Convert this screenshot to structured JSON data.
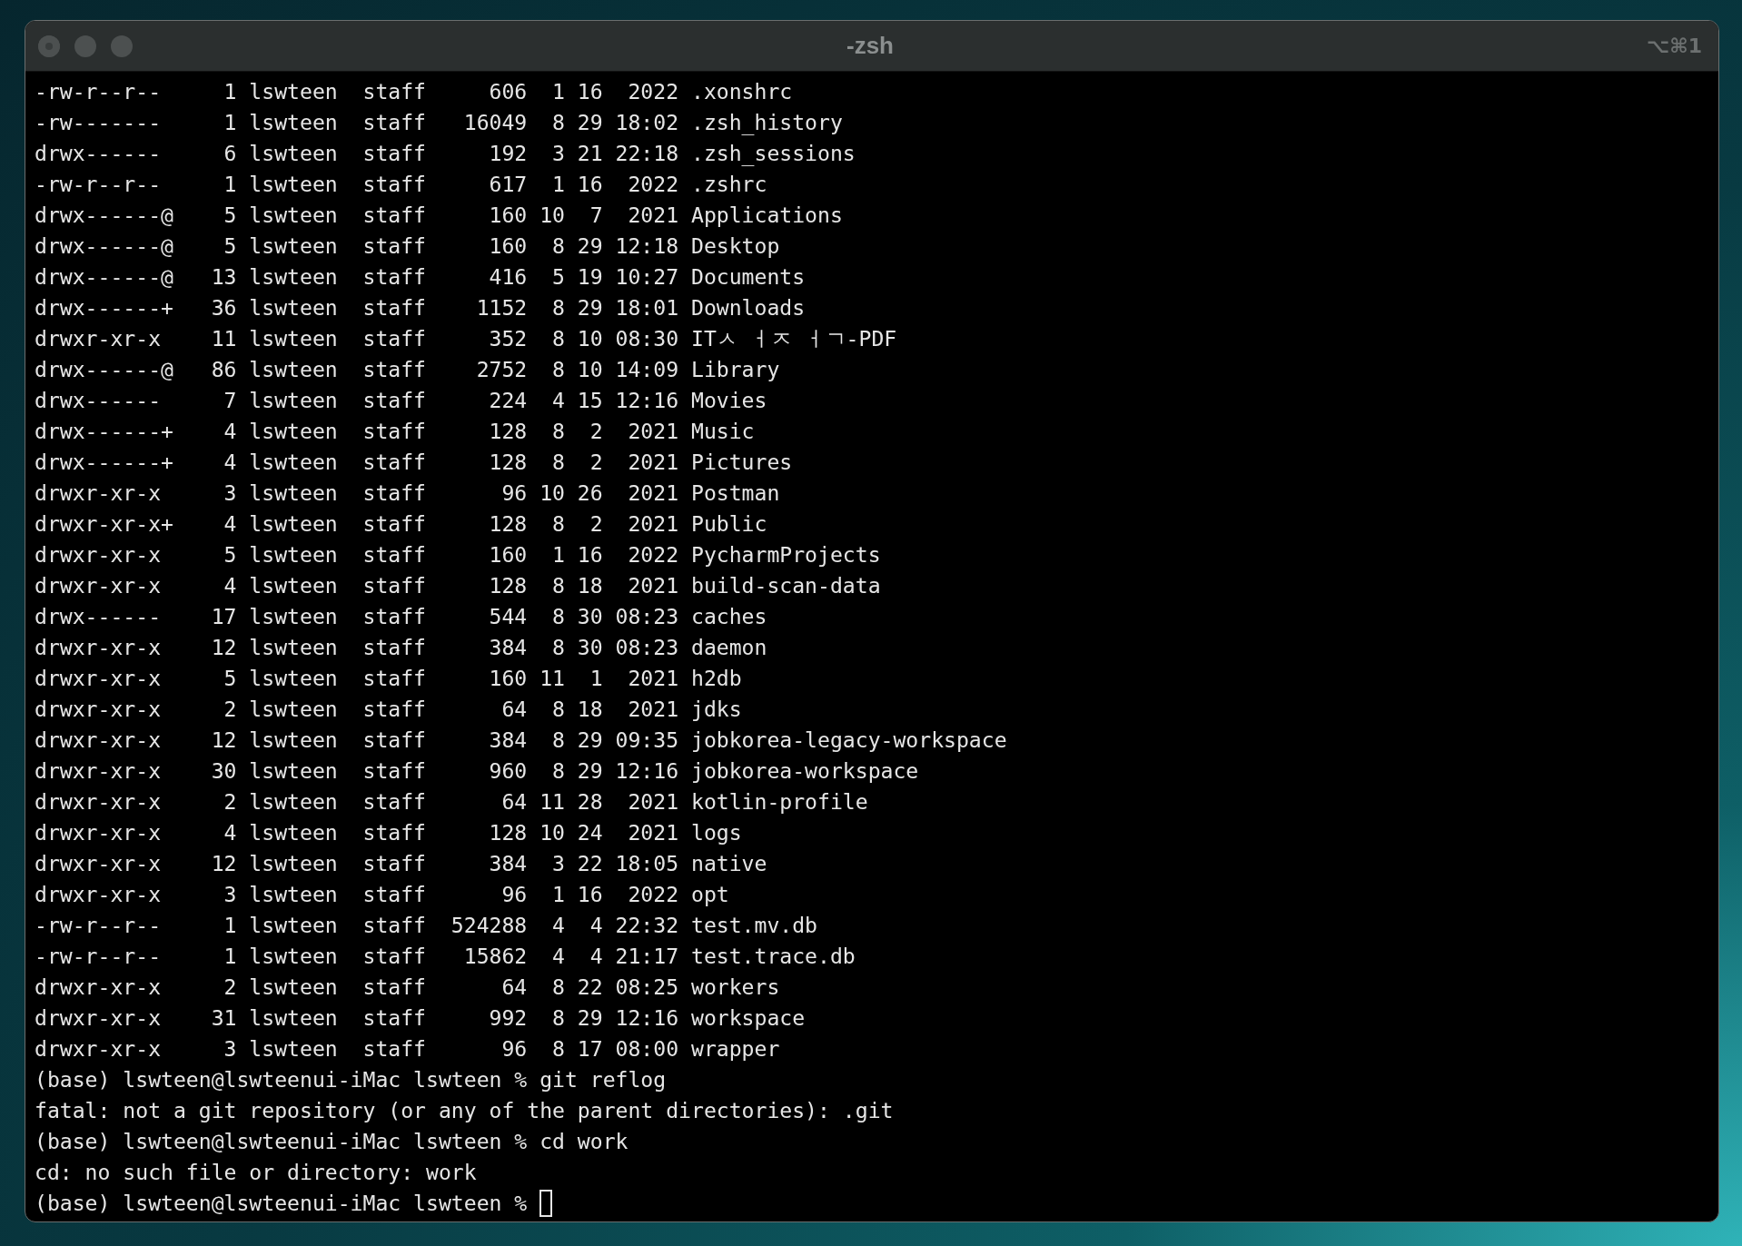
{
  "window": {
    "title": "-zsh",
    "shortcut": "⌥⌘1"
  },
  "lines": [
    {
      "text": "-rw-r--r--     1 lswteen  staff     606  1 16  2022 .xonshrc",
      "cursor": false
    },
    {
      "text": "-rw-------     1 lswteen  staff   16049  8 29 18:02 .zsh_history",
      "cursor": false
    },
    {
      "text": "drwx------     6 lswteen  staff     192  3 21 22:18 .zsh_sessions",
      "cursor": false
    },
    {
      "text": "-rw-r--r--     1 lswteen  staff     617  1 16  2022 .zshrc",
      "cursor": false
    },
    {
      "text": "drwx------@    5 lswteen  staff     160 10  7  2021 Applications",
      "cursor": false
    },
    {
      "text": "drwx------@    5 lswteen  staff     160  8 29 12:18 Desktop",
      "cursor": false
    },
    {
      "text": "drwx------@   13 lswteen  staff     416  5 19 10:27 Documents",
      "cursor": false
    },
    {
      "text": "drwx------+   36 lswteen  staff    1152  8 29 18:01 Downloads",
      "cursor": false
    },
    {
      "text": "drwxr-xr-x    11 lswteen  staff     352  8 10 08:30 ITㅅ ㅓㅈ ㅓㄱ-PDF",
      "cursor": false
    },
    {
      "text": "drwx------@   86 lswteen  staff    2752  8 10 14:09 Library",
      "cursor": false
    },
    {
      "text": "drwx------     7 lswteen  staff     224  4 15 12:16 Movies",
      "cursor": false
    },
    {
      "text": "drwx------+    4 lswteen  staff     128  8  2  2021 Music",
      "cursor": false
    },
    {
      "text": "drwx------+    4 lswteen  staff     128  8  2  2021 Pictures",
      "cursor": false
    },
    {
      "text": "drwxr-xr-x     3 lswteen  staff      96 10 26  2021 Postman",
      "cursor": false
    },
    {
      "text": "drwxr-xr-x+    4 lswteen  staff     128  8  2  2021 Public",
      "cursor": false
    },
    {
      "text": "drwxr-xr-x     5 lswteen  staff     160  1 16  2022 PycharmProjects",
      "cursor": false
    },
    {
      "text": "drwxr-xr-x     4 lswteen  staff     128  8 18  2021 build-scan-data",
      "cursor": false
    },
    {
      "text": "drwx------    17 lswteen  staff     544  8 30 08:23 caches",
      "cursor": false
    },
    {
      "text": "drwxr-xr-x    12 lswteen  staff     384  8 30 08:23 daemon",
      "cursor": false
    },
    {
      "text": "drwxr-xr-x     5 lswteen  staff     160 11  1  2021 h2db",
      "cursor": false
    },
    {
      "text": "drwxr-xr-x     2 lswteen  staff      64  8 18  2021 jdks",
      "cursor": false
    },
    {
      "text": "drwxr-xr-x    12 lswteen  staff     384  8 29 09:35 jobkorea-legacy-workspace",
      "cursor": false
    },
    {
      "text": "drwxr-xr-x    30 lswteen  staff     960  8 29 12:16 jobkorea-workspace",
      "cursor": false
    },
    {
      "text": "drwxr-xr-x     2 lswteen  staff      64 11 28  2021 kotlin-profile",
      "cursor": false
    },
    {
      "text": "drwxr-xr-x     4 lswteen  staff     128 10 24  2021 logs",
      "cursor": false
    },
    {
      "text": "drwxr-xr-x    12 lswteen  staff     384  3 22 18:05 native",
      "cursor": false
    },
    {
      "text": "drwxr-xr-x     3 lswteen  staff      96  1 16  2022 opt",
      "cursor": false
    },
    {
      "text": "-rw-r--r--     1 lswteen  staff  524288  4  4 22:32 test.mv.db",
      "cursor": false
    },
    {
      "text": "-rw-r--r--     1 lswteen  staff   15862  4  4 21:17 test.trace.db",
      "cursor": false
    },
    {
      "text": "drwxr-xr-x     2 lswteen  staff      64  8 22 08:25 workers",
      "cursor": false
    },
    {
      "text": "drwxr-xr-x    31 lswteen  staff     992  8 29 12:16 workspace",
      "cursor": false
    },
    {
      "text": "drwxr-xr-x     3 lswteen  staff      96  8 17 08:00 wrapper",
      "cursor": false
    },
    {
      "text": "(base) lswteen@lswteenui-iMac lswteen % git reflog",
      "cursor": false
    },
    {
      "text": "fatal: not a git repository (or any of the parent directories): .git",
      "cursor": false
    },
    {
      "text": "(base) lswteen@lswteenui-iMac lswteen % cd work",
      "cursor": false
    },
    {
      "text": "cd: no such file or directory: work",
      "cursor": false
    },
    {
      "text": "(base) lswteen@lswteenui-iMac lswteen %",
      "cursor": true
    }
  ]
}
